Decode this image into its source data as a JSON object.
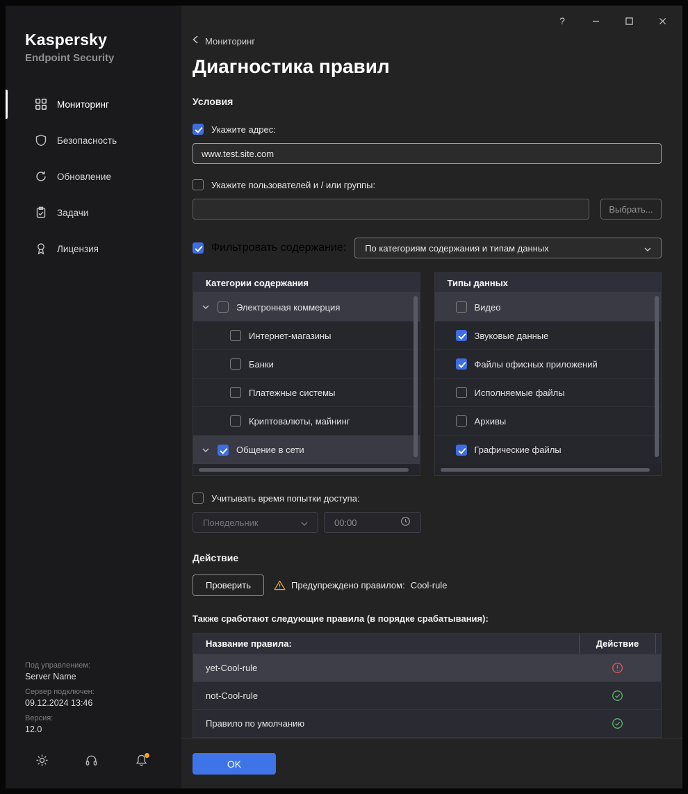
{
  "titlebar": {
    "help": "?"
  },
  "brand": {
    "name": "Kaspersky",
    "product": "Endpoint Security"
  },
  "sidebar": {
    "items": [
      {
        "label": "Мониторинг",
        "active": true
      },
      {
        "label": "Безопасность",
        "active": false
      },
      {
        "label": "Обновление",
        "active": false
      },
      {
        "label": "Задачи",
        "active": false
      },
      {
        "label": "Лицензия",
        "active": false
      }
    ],
    "footer": {
      "managed_label": "Под управлением:",
      "server_name": "Server Name",
      "connected_label": "Сервер подключен:",
      "connected_value": "09.12.2024 13:46",
      "version_label": "Версия:",
      "version_value": "12.0"
    }
  },
  "page": {
    "breadcrumb": "Мониторинг",
    "title": "Диагностика правил",
    "conditions_heading": "Условия",
    "action_heading": "Действие"
  },
  "conditions": {
    "address": {
      "label": "Укажите адрес:",
      "value": "www.test.site.com",
      "checked": true
    },
    "users": {
      "label": "Укажите пользователей и / или группы:",
      "value": "",
      "checked": false,
      "choose_button": "Выбрать..."
    },
    "filter": {
      "label": "Фильтровать содержание:",
      "checked": true,
      "selected": "По категориям содержания и типам данных"
    },
    "time": {
      "label": "Учитывать время попытки доступа:",
      "checked": false,
      "day": "Понедельник",
      "time": "00:00"
    }
  },
  "categories_panel": {
    "header": "Категории содержания",
    "items": [
      {
        "label": "Электронная коммерция",
        "checked": false,
        "expanded": true,
        "level": 0,
        "highlighted": true
      },
      {
        "label": "Интернет-магазины",
        "checked": false,
        "level": 1,
        "highlighted": false
      },
      {
        "label": "Банки",
        "checked": false,
        "level": 1,
        "highlighted": false
      },
      {
        "label": "Платежные системы",
        "checked": false,
        "level": 1,
        "highlighted": false
      },
      {
        "label": "Криптовалюты, майнинг",
        "checked": false,
        "level": 1,
        "highlighted": false
      },
      {
        "label": "Общение в сети",
        "checked": true,
        "expanded": true,
        "level": 0,
        "highlighted": true
      }
    ]
  },
  "datatypes_panel": {
    "header": "Типы данных",
    "items": [
      {
        "label": "Видео",
        "checked": false,
        "highlighted": true
      },
      {
        "label": "Звуковые данные",
        "checked": true,
        "highlighted": false
      },
      {
        "label": "Файлы офисных приложений",
        "checked": true,
        "highlighted": false
      },
      {
        "label": "Исполняемые файлы",
        "checked": false,
        "highlighted": false
      },
      {
        "label": "Архивы",
        "checked": false,
        "highlighted": false
      },
      {
        "label": "Графические файлы",
        "checked": true,
        "highlighted": false
      }
    ]
  },
  "action": {
    "check_button": "Проверить",
    "warning_label": "Предупреждено правилом:",
    "warning_rule": "Cool-rule",
    "rules_note": "Также сработают следующие правила (в порядке срабатывания):",
    "table": {
      "name_header": "Название правила:",
      "action_header": "Действие",
      "rows": [
        {
          "name": "yet-Cool-rule",
          "status": "blocked"
        },
        {
          "name": "not-Cool-rule",
          "status": "allowed"
        },
        {
          "name": "Правило по умолчанию",
          "status": "allowed"
        }
      ]
    }
  },
  "footer": {
    "ok_button": "OK"
  },
  "colors": {
    "accent": "#3e6de0",
    "warning": "#e9a23b",
    "blocked": "#e05a5a",
    "allowed": "#55b663",
    "bell_badge": "#f0a529"
  }
}
